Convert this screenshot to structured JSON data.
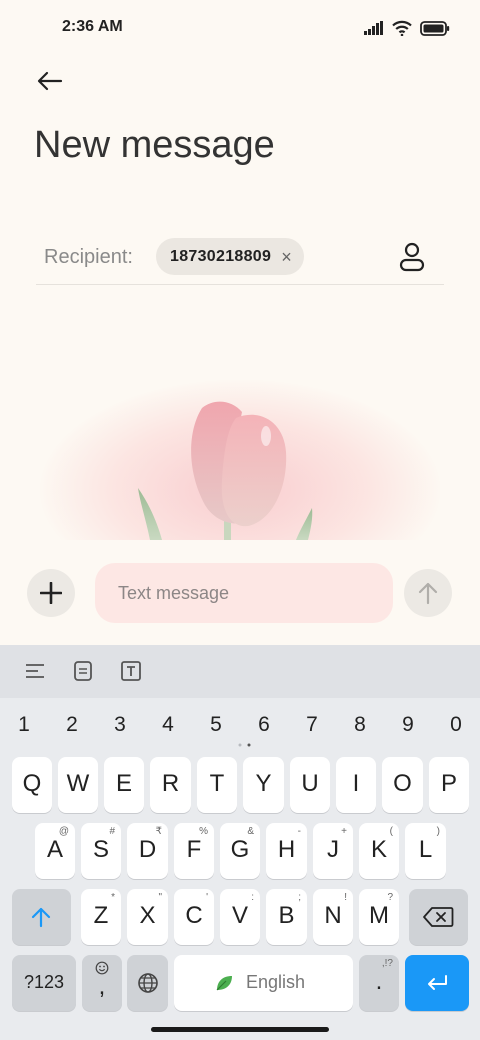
{
  "status_bar": {
    "time": "2:36 AM"
  },
  "header": {
    "title": "New message"
  },
  "recipient": {
    "label": "Recipient:",
    "chip_number": "18730218809",
    "chip_remove": "×"
  },
  "compose": {
    "placeholder": "Text message"
  },
  "keyboard": {
    "numbers": [
      "1",
      "2",
      "3",
      "4",
      "5",
      "6",
      "7",
      "8",
      "9",
      "0"
    ],
    "row1": [
      "Q",
      "W",
      "E",
      "R",
      "T",
      "Y",
      "U",
      "I",
      "O",
      "P"
    ],
    "row2": [
      {
        "key": "A",
        "hint": "@"
      },
      {
        "key": "S",
        "hint": "#"
      },
      {
        "key": "D",
        "hint": "₹"
      },
      {
        "key": "F",
        "hint": "%"
      },
      {
        "key": "G",
        "hint": "&"
      },
      {
        "key": "H",
        "hint": "-"
      },
      {
        "key": "J",
        "hint": "+"
      },
      {
        "key": "K",
        "hint": "("
      },
      {
        "key": "L",
        "hint": ")"
      }
    ],
    "row3": [
      {
        "key": "Z",
        "hint": "*"
      },
      {
        "key": "X",
        "hint": "\""
      },
      {
        "key": "C",
        "hint": "'"
      },
      {
        "key": "V",
        "hint": ":"
      },
      {
        "key": "B",
        "hint": ";"
      },
      {
        "key": "N",
        "hint": "!"
      },
      {
        "key": "M",
        "hint": "?"
      }
    ],
    "symbols_label": "?123",
    "comma": ",",
    "space_label": "English",
    "period": ".",
    "period_hint": ",!?"
  },
  "colors": {
    "accent": "#1a98f7",
    "compose_bg": "#fde7e4",
    "page_bg": "#fdf9f3"
  }
}
